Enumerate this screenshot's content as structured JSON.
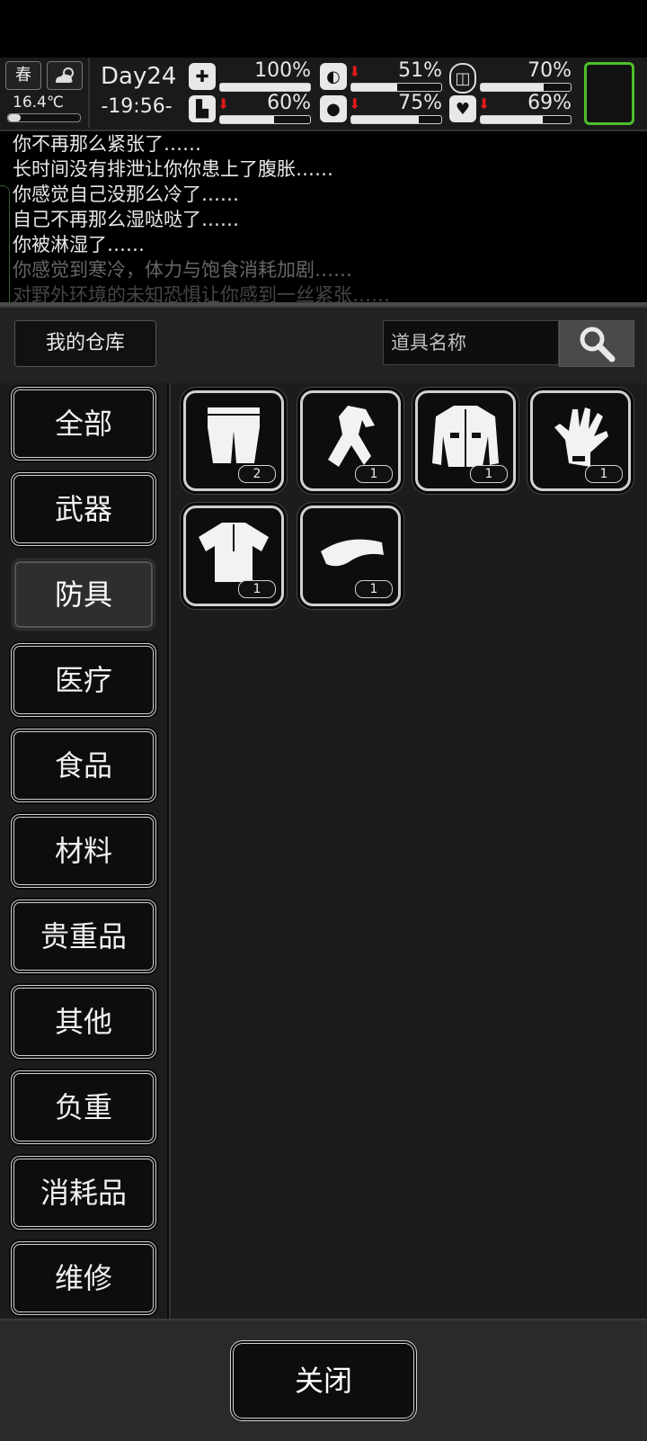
{
  "status": {
    "season": "春",
    "temperature": "16.4℃",
    "temperature_level": 0.18,
    "day": "Day24",
    "time": "-19:56-",
    "stats": [
      {
        "icon": "medkit-icon",
        "value": "100%",
        "level": 1.0,
        "declining": false
      },
      {
        "icon": "stomach-icon",
        "value": "51%",
        "level": 0.51,
        "declining": true
      },
      {
        "icon": "bladder-icon",
        "value": "70%",
        "level": 0.7,
        "declining": false
      },
      {
        "icon": "boot-icon",
        "value": "60%",
        "level": 0.6,
        "declining": true
      },
      {
        "icon": "water-drop-icon",
        "value": "75%",
        "level": 0.75,
        "declining": true
      },
      {
        "icon": "heart-icon",
        "value": "69%",
        "level": 0.69,
        "declining": true
      }
    ]
  },
  "log": [
    "你不再那么紧张了……",
    "长时间没有排泄让你你患上了腹胀……",
    "你感觉自己没那么冷了……",
    "自己不再那么湿哒哒了……",
    "你被淋湿了……",
    "你感觉到寒冷，体力与饱食消耗加剧……",
    "对野外环境的未知恐惧让你感到一丝紧张……"
  ],
  "header": {
    "title": "我的仓库",
    "search_placeholder": "道具名称"
  },
  "categories": [
    "全部",
    "武器",
    "防具",
    "医疗",
    "食品",
    "材料",
    "贵重品",
    "其他",
    "负重",
    "消耗品",
    "维修"
  ],
  "active_category": "防具",
  "items": [
    {
      "icon": "pants-icon",
      "count": "2"
    },
    {
      "icon": "tracksuit-icon",
      "count": "1"
    },
    {
      "icon": "jacket-icon",
      "count": "1"
    },
    {
      "icon": "glove-icon",
      "count": "1"
    },
    {
      "icon": "shirt-icon",
      "count": "1"
    },
    {
      "icon": "visor-cap-icon",
      "count": "1"
    }
  ],
  "footer": {
    "close_label": "关闭"
  }
}
